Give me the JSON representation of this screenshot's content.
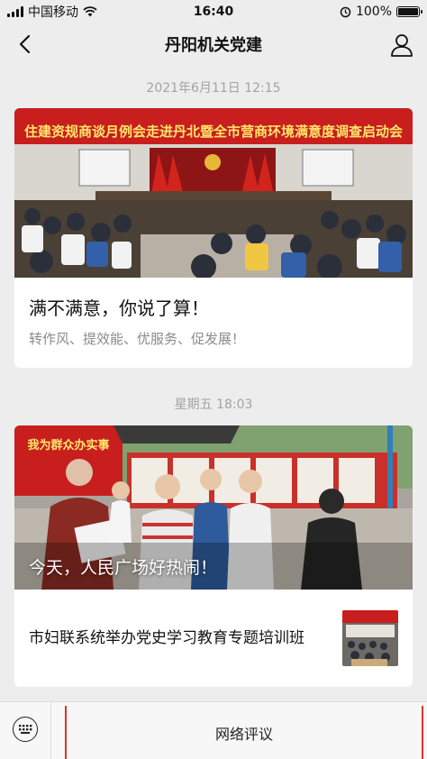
{
  "status_bar": {
    "carrier": "中国移动",
    "time": "16:40",
    "battery": "100%"
  },
  "nav": {
    "title": "丹阳机关党建"
  },
  "messages": [
    {
      "timestamp": "2021年6月11日 12:15",
      "banner_text": "住建资规商谈月例会走进丹北暨全市营商环境满意度调查启动会",
      "title": "满不满意，你说了算！",
      "subtitle": "转作风、提效能、优服务、促发展！"
    },
    {
      "timestamp": "星期五 18:03",
      "banner_text": "我为群众办实事",
      "image_caption": "今天，人民广场好热闹！",
      "sub_article_title": "市妇联系统举办党史学习教育专题培训班"
    }
  ],
  "bottom_menu": {
    "item_label": "网络评议"
  },
  "colors": {
    "background": "#ededed",
    "card": "#ffffff",
    "banner_red": "#c81e1e",
    "menu_highlight": "#dd3333"
  }
}
